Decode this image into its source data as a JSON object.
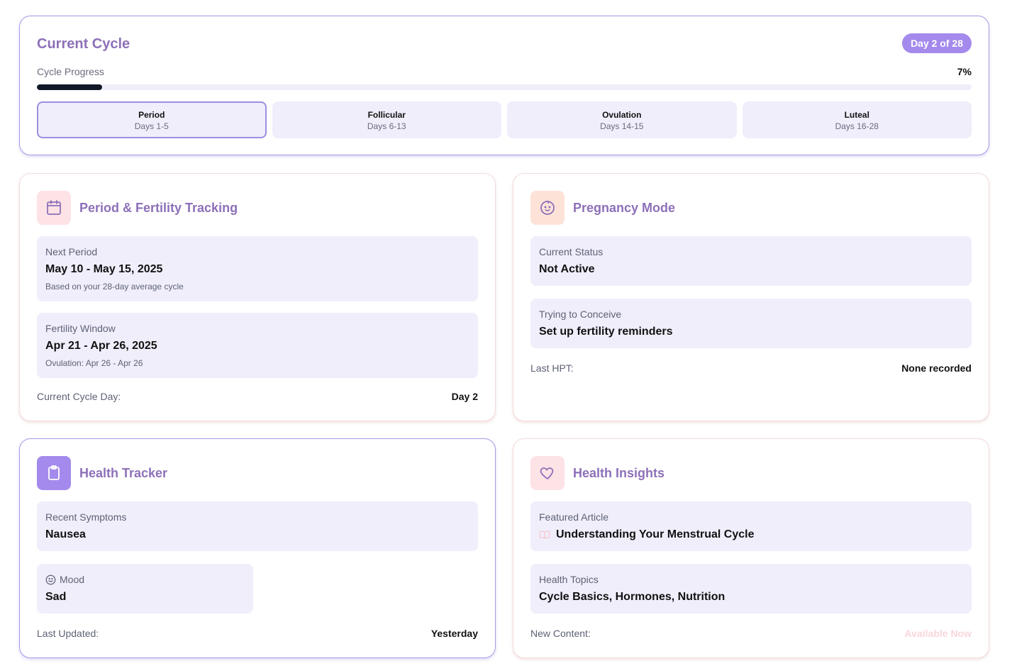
{
  "cycle": {
    "title": "Current Cycle",
    "day_badge": "Day 2 of 28",
    "progress_label": "Cycle Progress",
    "progress_text": "7%",
    "progress_fraction": 0.07,
    "phases": [
      {
        "name": "Period",
        "days": "Days 1-5",
        "active": true
      },
      {
        "name": "Follicular",
        "days": "Days 6-13",
        "active": false
      },
      {
        "name": "Ovulation",
        "days": "Days 14-15",
        "active": false
      },
      {
        "name": "Luteal",
        "days": "Days 16-28",
        "active": false
      }
    ]
  },
  "fertility": {
    "title": "Period & Fertility Tracking",
    "icon": "calendar-icon",
    "next_period": {
      "label": "Next Period",
      "value": "May 10 - May 15, 2025",
      "note": "Based on your 28-day average cycle"
    },
    "fertility_window": {
      "label": "Fertility Window",
      "value": "Apr 21 - Apr 26, 2025",
      "note": "Ovulation: Apr 26 - Apr 26"
    },
    "footer": {
      "label": "Current Cycle Day:",
      "value": "Day 2"
    }
  },
  "pregnancy": {
    "title": "Pregnancy Mode",
    "icon": "baby-icon",
    "status": {
      "label": "Current Status",
      "value": "Not Active"
    },
    "conceive": {
      "label": "Trying to Conceive",
      "value": "Set up fertility reminders"
    },
    "footer": {
      "label": "Last HPT:",
      "value": "None recorded"
    }
  },
  "health": {
    "title": "Health Tracker",
    "icon": "clipboard-icon",
    "symptoms": {
      "label": "Recent Symptoms",
      "value": "Nausea"
    },
    "mood": {
      "label": "Mood",
      "value": "Sad"
    },
    "footer": {
      "label": "Last Updated:",
      "value": "Yesterday"
    }
  },
  "insights": {
    "title": "Health Insights",
    "icon": "heart-icon",
    "article": {
      "label": "Featured Article",
      "value": "Understanding Your Menstrual Cycle"
    },
    "topics": {
      "label": "Health Topics",
      "value": "Cycle Basics, Hormones, Nutrition"
    },
    "footer": {
      "label": "New Content:",
      "value": "Available Now"
    }
  },
  "colors": {
    "accent_purple": "#8d70b8",
    "badge_purple": "#a48aec",
    "panel_lavender": "#f0eefb",
    "progress_fill": "#111827",
    "available_pink": "#f9d6dc"
  }
}
